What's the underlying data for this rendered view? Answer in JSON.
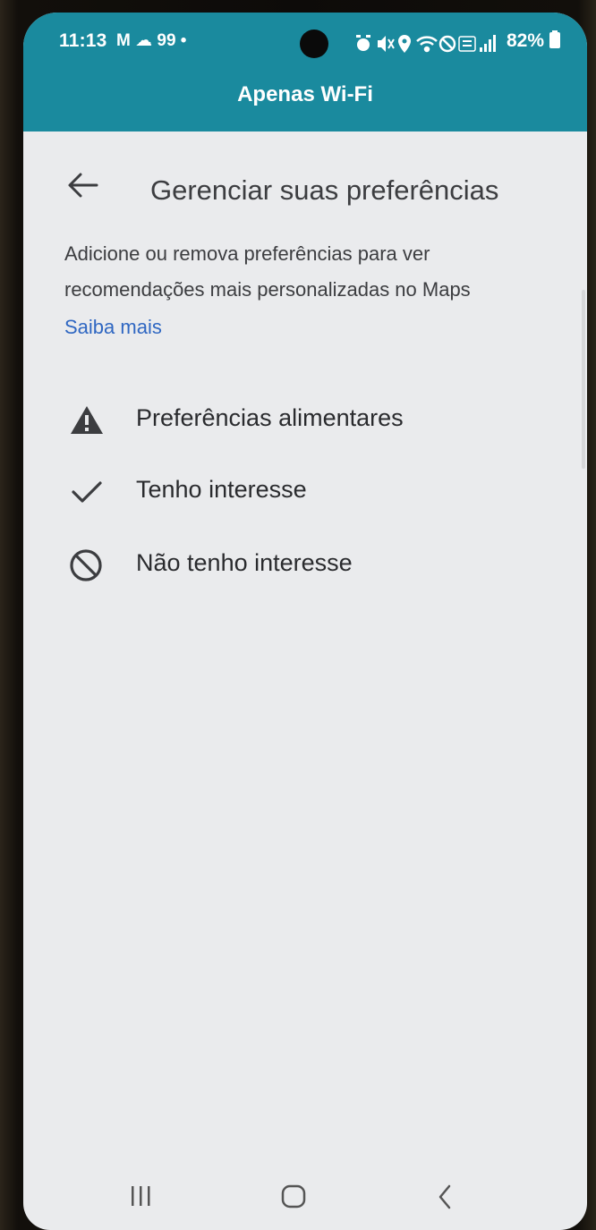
{
  "status_bar": {
    "time": "11:13",
    "left_icons_text": "M ☁ 99 •",
    "right_icons": [
      "alarm-icon",
      "mute-icon",
      "location-icon",
      "wifi-icon",
      "do-not-disturb-icon",
      "volte-icon",
      "signal-icon"
    ],
    "battery": "82%",
    "network_banner": "Apenas Wi-Fi",
    "color": "#1a8a9e"
  },
  "header": {
    "title": "Gerenciar suas preferências"
  },
  "description": "Adicione ou remova preferências para ver recomendações mais personalizadas no Maps",
  "learn_more": "Saiba mais",
  "link_color": "#2f67c2",
  "preferences": [
    {
      "label": "Preferências alimentares",
      "icon": "warning-icon"
    },
    {
      "label": "Tenho interesse",
      "icon": "check-icon"
    },
    {
      "label": "Não tenho interesse",
      "icon": "block-icon"
    }
  ],
  "nav": [
    "recent-apps-icon",
    "home-icon",
    "back-icon"
  ]
}
